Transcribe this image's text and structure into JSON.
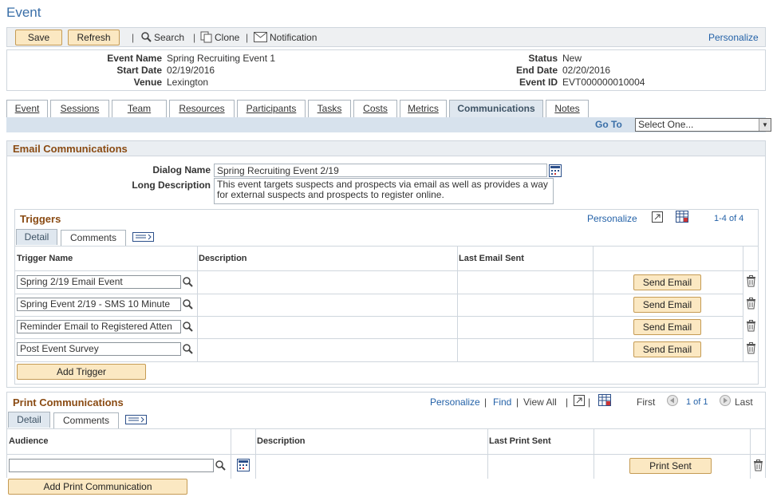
{
  "page": {
    "title": "Event"
  },
  "toolbar": {
    "save": "Save",
    "refresh": "Refresh",
    "search": "Search",
    "clone": "Clone",
    "notification": "Notification",
    "personalize": "Personalize",
    "separator": "|"
  },
  "header": {
    "event_name_label": "Event Name",
    "event_name": "Spring Recruiting Event 1",
    "start_date_label": "Start Date",
    "start_date": "02/19/2016",
    "venue_label": "Venue",
    "venue": "Lexington",
    "status_label": "Status",
    "status": "New",
    "end_date_label": "End Date",
    "end_date": "02/20/2016",
    "event_id_label": "Event ID",
    "event_id": "EVT000000010004"
  },
  "tabs": [
    {
      "label": "Event"
    },
    {
      "label": "Sessions"
    },
    {
      "label": "Team"
    },
    {
      "label": "Resources"
    },
    {
      "label": "Participants"
    },
    {
      "label": "Tasks"
    },
    {
      "label": "Costs"
    },
    {
      "label": "Metrics"
    },
    {
      "label": "Communications"
    },
    {
      "label": "Notes"
    }
  ],
  "goto": {
    "label": "Go To",
    "value": "Select One..."
  },
  "email": {
    "title": "Email Communications",
    "dialog_label": "Dialog Name",
    "dialog_value": "Spring Recruiting Event 2/19",
    "long_desc_label": "Long Description",
    "long_desc_value": "This event targets suspects and prospects via email as well as provides a way for external suspects and prospects to register online.",
    "triggers": {
      "title": "Triggers",
      "personalize": "Personalize",
      "range": "1-4 of 4",
      "tab_detail": "Detail",
      "tab_comments": "Comments",
      "col_name": "Trigger Name",
      "col_desc": "Description",
      "col_last": "Last Email Sent",
      "send_label": "Send Email",
      "add_label": "Add Trigger",
      "rows": [
        {
          "name": "Spring 2/19 Email Event"
        },
        {
          "name": "Spring Event 2/19 - SMS 10 Minute"
        },
        {
          "name": "Reminder Email to Registered Atten"
        },
        {
          "name": "Post Event Survey"
        }
      ]
    }
  },
  "print": {
    "title": "Print Communications",
    "personalize": "Personalize",
    "find": "Find",
    "view_all": "View All",
    "first": "First",
    "range": "1 of 1",
    "last": "Last",
    "tab_detail": "Detail",
    "tab_comments": "Comments",
    "col_audience": "Audience",
    "col_desc": "Description",
    "col_last": "Last Print Sent",
    "audience_value": "",
    "print_sent_label": "Print Sent",
    "add_label": "Add Print Communication"
  },
  "colors": {
    "accent": "#3a6fa8",
    "section_title": "#8a4b13",
    "button_bg": "#fbe8c2",
    "link": "#2462a8"
  }
}
